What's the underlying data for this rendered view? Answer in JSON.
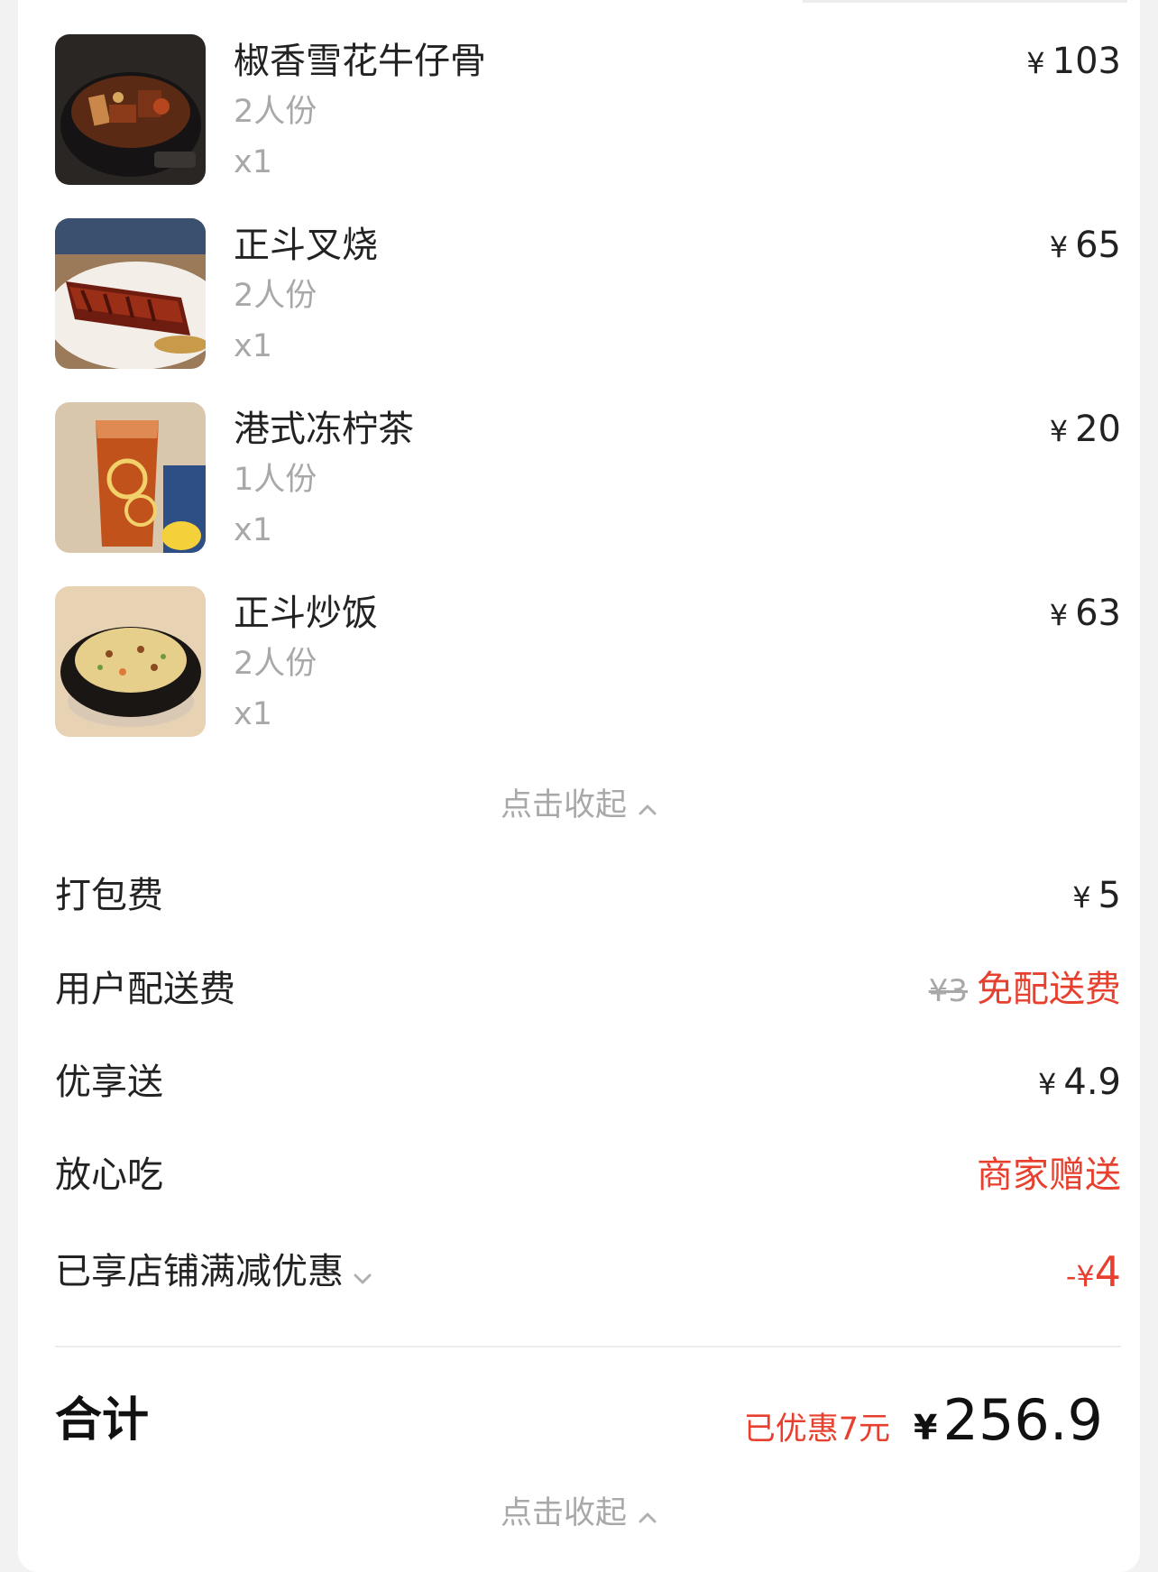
{
  "items": [
    {
      "name": "椒香雪花牛仔骨",
      "portion": "2人份",
      "qty": "x1",
      "currency": "¥",
      "price": "103",
      "image": "beef-rib-claypot-photo"
    },
    {
      "name": "正斗叉烧",
      "portion": "2人份",
      "qty": "x1",
      "currency": "¥",
      "price": "65",
      "image": "char-siu-photo"
    },
    {
      "name": "港式冻柠茶",
      "portion": "1人份",
      "qty": "x1",
      "currency": "¥",
      "price": "20",
      "image": "iced-lemon-tea-photo"
    },
    {
      "name": "正斗炒饭",
      "portion": "2人份",
      "qty": "x1",
      "currency": "¥",
      "price": "63",
      "image": "fried-rice-photo"
    }
  ],
  "collapse_label": "点击收起",
  "fees": {
    "packing": {
      "label": "打包费",
      "currency": "¥",
      "value": "5"
    },
    "delivery": {
      "label": "用户配送费",
      "original": "¥3",
      "value": "免配送费"
    },
    "priority": {
      "label": "优享送",
      "currency": "¥",
      "value": "4.9"
    },
    "assurance": {
      "label": "放心吃",
      "value": "商家赠送"
    },
    "store_discount": {
      "label": "已享店铺满减优惠",
      "prefix": "-¥",
      "value": "4"
    }
  },
  "total": {
    "label": "合计",
    "saved_note": "已优惠7元",
    "currency": "¥",
    "amount": "256.9"
  },
  "colors": {
    "accent_red": "#e8402f",
    "muted_gray": "#a8a8a8",
    "text": "#222222"
  }
}
